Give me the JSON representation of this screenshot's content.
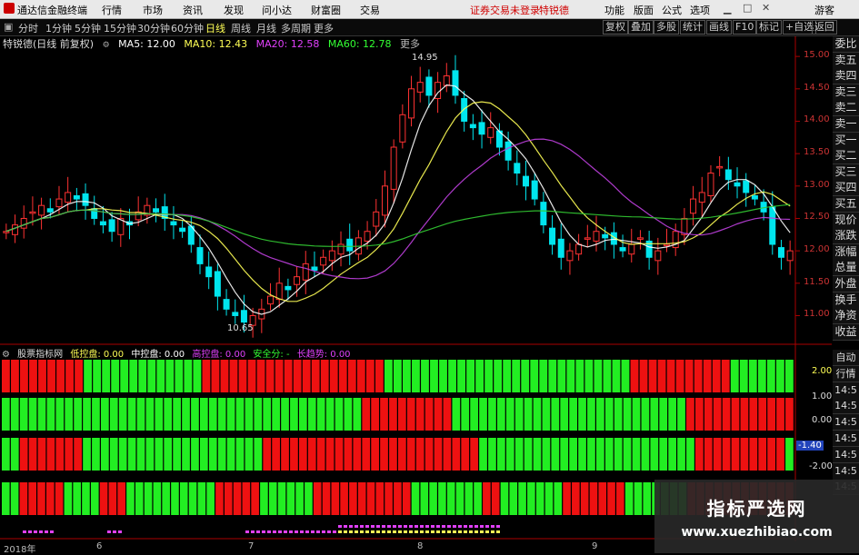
{
  "app": {
    "title": "通达信金融终端",
    "menu": [
      "行情",
      "市场",
      "资讯",
      "发现",
      "问小达",
      "财富圈",
      "交易"
    ],
    "status_notice": "证券交易未登录",
    "stock_name_short": "特锐德",
    "menu_right": [
      "功能",
      "版面",
      "公式",
      "选项"
    ],
    "guest": "游客"
  },
  "toolbar": {
    "periods": [
      "分时",
      "1分钟",
      "5分钟",
      "15分钟",
      "30分钟",
      "60分钟",
      "日线",
      "周线",
      "月线",
      "多周期",
      "更多"
    ],
    "selected_period": "日线",
    "right": [
      "复权",
      "叠加",
      "多股",
      "统计",
      "画线",
      "F10",
      "标记",
      "+自选",
      "返回"
    ]
  },
  "info": {
    "stock": "特锐德(日线 前复权)",
    "ma": [
      {
        "label": "MA5: 12.00",
        "color": "#ffffff"
      },
      {
        "label": "MA10: 12.43",
        "color": "#ffff55"
      },
      {
        "label": "MA20: 12.58",
        "color": "#e040fb"
      },
      {
        "label": "MA60: 12.78",
        "color": "#33ff33"
      }
    ],
    "more": "更多"
  },
  "price_axis": [
    "15.00",
    "14.50",
    "14.00",
    "13.50",
    "13.00",
    "12.50",
    "12.00",
    "11.50",
    "11.00"
  ],
  "annotations": {
    "high": "14.95",
    "low": "10.65"
  },
  "side_panel": [
    "委比",
    "卖五",
    "卖四",
    "卖三",
    "卖二",
    "卖一",
    "买一",
    "买二",
    "买三",
    "买四",
    "买五",
    "现价",
    "涨跌",
    "涨幅",
    "总量",
    "外盘",
    "换手",
    "净资",
    "收益",
    "自动",
    "行情",
    "14:5",
    "14:5",
    "14:5",
    "14:5",
    "14:5",
    "14:5",
    "14:5"
  ],
  "indicator": {
    "name": "股票指标网",
    "fields": [
      {
        "label": "低控盘: 0.00",
        "color": "#ffff55"
      },
      {
        "label": "中控盘: 0.00",
        "color": "#ffffff"
      },
      {
        "label": "高控盘: 0.00",
        "color": "#e040fb"
      },
      {
        "label": "安全分: -",
        "color": "#33ff33"
      },
      {
        "label": "长趋势: 0.00",
        "color": "#e040fb"
      }
    ],
    "axis": [
      "2.00",
      "1.00",
      "0.00",
      "-1.40",
      "-2.00"
    ]
  },
  "dates": [
    "2018年",
    "6",
    "7",
    "8",
    "9"
  ],
  "watermark": {
    "title": "指标严选网",
    "url": "www.xuezhibiao.com"
  },
  "colors": {
    "up": "#ff3232",
    "down": "#00e5ee",
    "bar_red": "#ee1111",
    "bar_green": "#22ee22"
  },
  "chart_data": {
    "type": "candlestick",
    "ylim": [
      10.6,
      15.1
    ],
    "closes": [
      12.3,
      12.4,
      12.5,
      12.6,
      12.7,
      12.6,
      12.8,
      12.9,
      12.8,
      12.7,
      12.5,
      12.4,
      12.3,
      12.5,
      12.4,
      12.6,
      12.7,
      12.6,
      12.5,
      12.4,
      12.3,
      12.1,
      11.8,
      11.6,
      11.3,
      11.1,
      11.0,
      10.9,
      11.0,
      11.1,
      11.3,
      11.5,
      11.4,
      11.6,
      11.8,
      11.7,
      11.9,
      12.0,
      12.1,
      12.0,
      12.2,
      12.3,
      12.6,
      13.0,
      13.6,
      14.1,
      14.5,
      14.6,
      14.4,
      14.6,
      14.7,
      14.4,
      14.0,
      13.9,
      13.8,
      13.9,
      13.6,
      13.4,
      13.2,
      13.0,
      12.8,
      12.4,
      12.1,
      11.9,
      12.0,
      12.1,
      12.2,
      12.3,
      12.2,
      12.1,
      12.0,
      12.1,
      12.2,
      11.9,
      12.0,
      12.1,
      12.3,
      12.5,
      12.8,
      12.9,
      13.2,
      13.3,
      13.1,
      13.0,
      12.9,
      12.8,
      12.6,
      12.1,
      11.9,
      12.0
    ]
  },
  "band_rows": [
    "RRRRRRRRRGGGGGGGGGGGGGRRRRRRRRRRRRRRRRRRRRGGGGGGGGGGGGGGGGGGGGGGGGGGGRRRRRRRRRRRGGGGGGG",
    "GGGGGGGGGGGGGGGGGGGGGGGGGGGGGGGGGGGGGGGGRRRRRRRRRRGGGGGGGGGGGGGGGGGGGGGGGGGGRRRRRRRRRRRR",
    "GGRRRRRRRGGGGGGGGGGGGGGGGGGGGRRRRRRRRRRRRRRRRRRRRRRRRGGGGGGGGGGGGGGGGGGGGGGGGRRRRRRRRRRG",
    "GGRRRRRGGGGRRRGGGGGGGGGGRRRRRGGGGGGRRRRRRRRRRRGGGGGGGGRRGGGGGGGRRRRRRRGGGGGGGRRRRRRRRRRRR"
  ]
}
